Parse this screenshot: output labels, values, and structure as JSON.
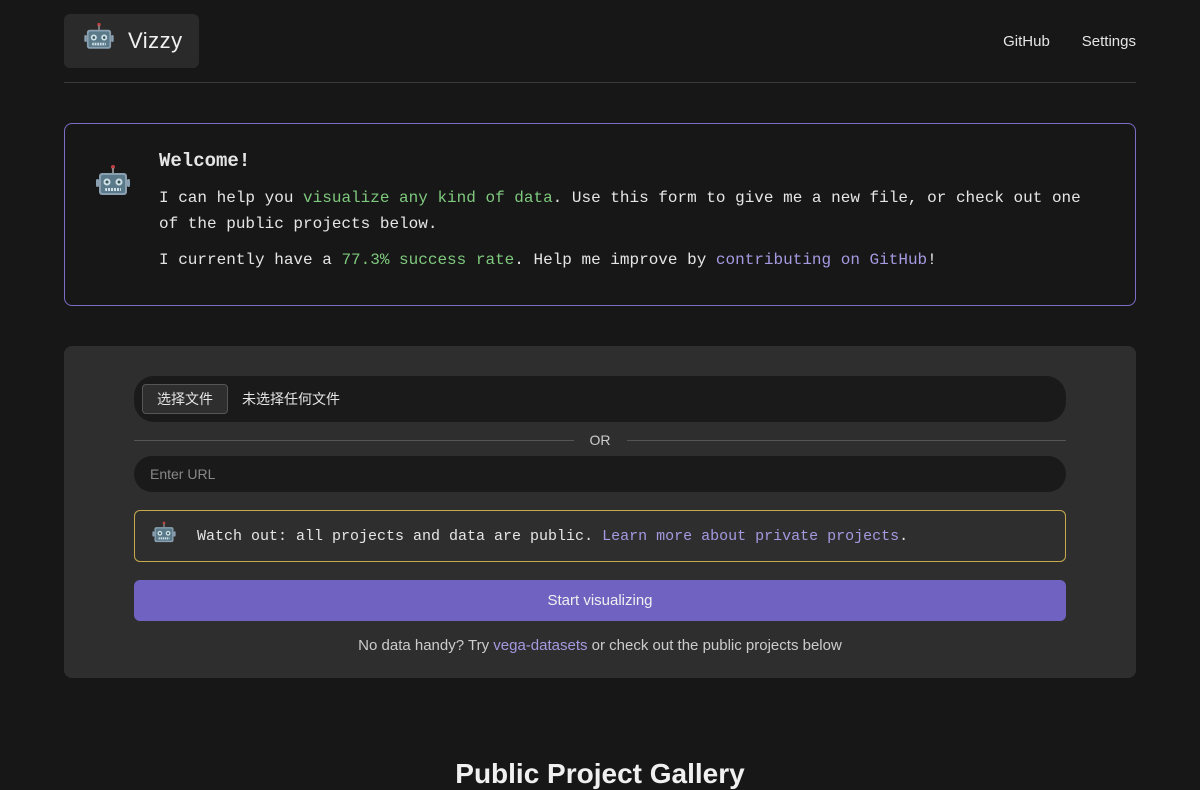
{
  "header": {
    "brand": "Vizzy",
    "nav": {
      "github": "GitHub",
      "settings": "Settings"
    }
  },
  "welcome": {
    "title": "Welcome!",
    "p1_a": "I can help you ",
    "p1_highlight": "visualize any kind of data",
    "p1_b": ". Use this form to give me a new file, or check out one of the public projects below.",
    "p2_a": "I currently have a ",
    "p2_rate": "77.3% success rate",
    "p2_b": ". Help me improve by ",
    "p2_link": "contributing on GitHub",
    "p2_c": "!"
  },
  "form": {
    "file_button": "选择文件",
    "file_status": "未选择任何文件",
    "divider": "OR",
    "url_placeholder": "Enter URL",
    "warning_a": "Watch out: all projects and data are public. ",
    "warning_link": "Learn more about private projects",
    "warning_b": ".",
    "submit": "Start visualizing",
    "footer_a": "No data handy? Try ",
    "footer_link": "vega-datasets",
    "footer_b": " or check out the public projects below"
  },
  "gallery": {
    "heading": "Public Project Gallery"
  }
}
